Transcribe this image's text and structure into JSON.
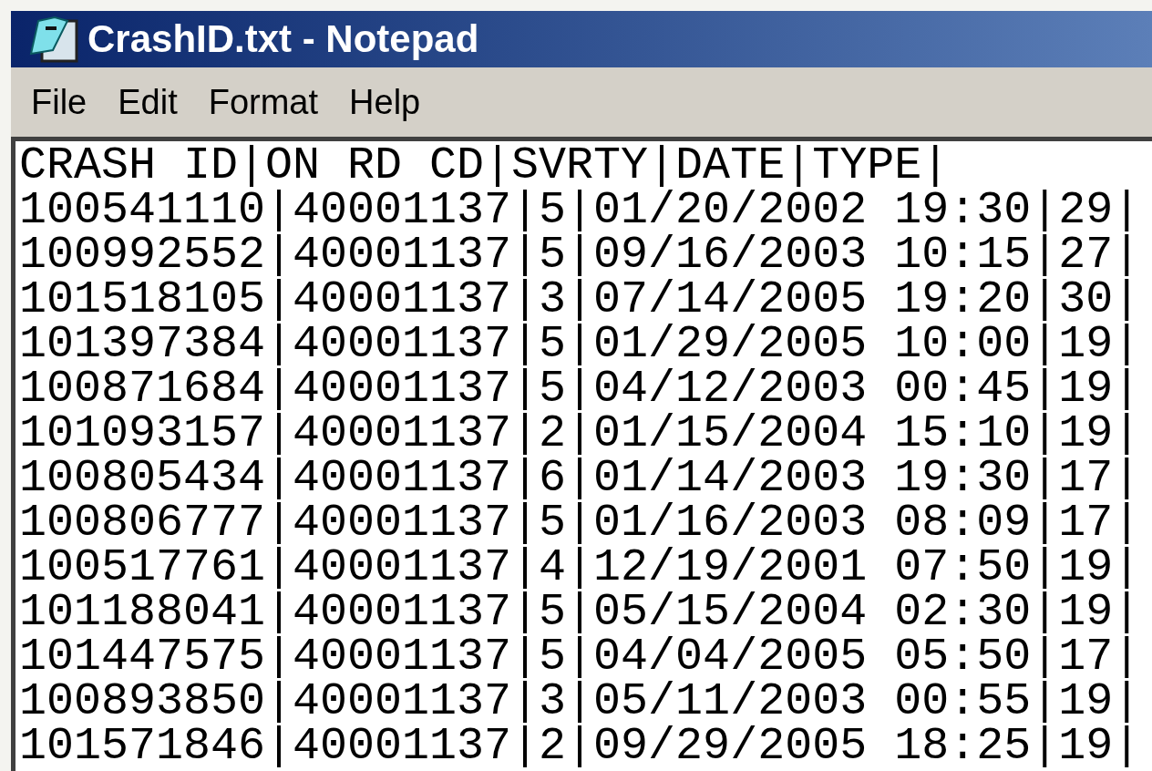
{
  "window": {
    "title": "CrashID.txt - Notepad"
  },
  "menu": [
    "File",
    "Edit",
    "Format",
    "Help"
  ],
  "editor": {
    "lines": [
      "CRASH ID|ON RD CD|SVRTY|DATE|TYPE|",
      "100541110|40001137|5|01/20/2002 19:30|29|",
      "100992552|40001137|5|09/16/2003 10:15|27|",
      "101518105|40001137|3|07/14/2005 19:20|30|",
      "101397384|40001137|5|01/29/2005 10:00|19|",
      "100871684|40001137|5|04/12/2003 00:45|19|",
      "101093157|40001137|2|01/15/2004 15:10|19|",
      "100805434|40001137|6|01/14/2003 19:30|17|",
      "100806777|40001137|5|01/16/2003 08:09|17|",
      "100517761|40001137|4|12/19/2001 07:50|19|",
      "101188041|40001137|5|05/15/2004 02:30|19|",
      "101447575|40001137|5|04/04/2005 05:50|17|",
      "100893850|40001137|3|05/11/2003 00:55|19|",
      "101571846|40001137|2|09/29/2005 18:25|19|"
    ]
  }
}
